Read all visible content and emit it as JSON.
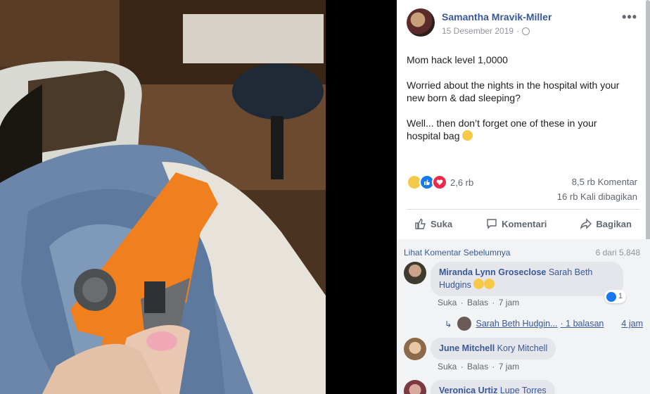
{
  "post": {
    "author": "Samantha Mravik-Miller",
    "date": "15 Desember 2019",
    "date_separator": "·",
    "paragraphs": [
      "Mom hack level 1,0000",
      "Worried about the nights in the hospital with your new born & dad sleeping?",
      "Well... then don’t forget one of these in your hospital bag"
    ],
    "more_menu": "•••"
  },
  "reactions": {
    "count": "2,6 rb",
    "icons": [
      "haha-icon",
      "like-icon",
      "love-icon"
    ],
    "comments": "8,5 rb Komentar",
    "shares": "16 rb Kali dibagikan"
  },
  "actions": {
    "like": "Suka",
    "comment": "Komentari",
    "share": "Bagikan"
  },
  "comments": {
    "view_previous": "Lihat Komentar Sebelumnya",
    "count": "6 dari 5.848",
    "items": [
      {
        "name": "Miranda Lynn Groseclose",
        "tag_line1": "Sarah Beth",
        "tag_line2": "Hudgins",
        "like_action": "Suka",
        "reply_action": "Balas",
        "time": "7 jam",
        "like_count": "1"
      },
      {
        "name": "June Mitchell",
        "tag": "Kory Mitchell",
        "like_action": "Suka",
        "reply_action": "Balas",
        "time": "7 jam"
      },
      {
        "name": "Veronica Urtiz",
        "tag": "Lupe Torres"
      }
    ],
    "reply": {
      "arrow": "↳",
      "name": "Sarah Beth Hudgin...",
      "count": "· 1 balasan",
      "time": "4 jam"
    },
    "separator": "·"
  },
  "colors": {
    "link": "#385898",
    "meta": "#606770",
    "comment_bg": "#f2f3f5",
    "bubble": "#e4e6eb",
    "like_blue": "#1877f2"
  }
}
